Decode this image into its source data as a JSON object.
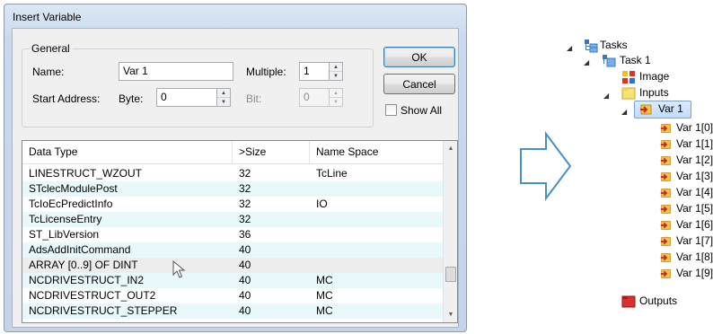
{
  "dialog": {
    "title": "Insert Variable",
    "general": {
      "legend": "General",
      "name_label": "Name:",
      "name_value": "Var 1",
      "multiple_label": "Multiple:",
      "multiple_value": "1",
      "start_address_label": "Start Address:",
      "byte_label": "Byte:",
      "byte_value": "0",
      "bit_label": "Bit:",
      "bit_value": "0"
    },
    "ok_label": "OK",
    "cancel_label": "Cancel",
    "show_all_label": "Show All",
    "show_all_checked": false,
    "list": {
      "columns": [
        "Data Type",
        ">Size",
        "Name Space"
      ],
      "rows": [
        {
          "type": "LINESTRUCT_WZOUT",
          "size": "32",
          "ns": "TcLine"
        },
        {
          "type": "STclecModulePost",
          "size": "32",
          "ns": ""
        },
        {
          "type": "TcIoEcPredictInfo",
          "size": "32",
          "ns": "IO"
        },
        {
          "type": "TcLicenseEntry",
          "size": "32",
          "ns": ""
        },
        {
          "type": "ST_LibVersion",
          "size": "36",
          "ns": ""
        },
        {
          "type": "AdsAddInitCommand",
          "size": "40",
          "ns": ""
        },
        {
          "type": "ARRAY [0..9] OF DINT",
          "size": "40",
          "ns": ""
        },
        {
          "type": "NCDRIVESTRUCT_IN2",
          "size": "40",
          "ns": "MC"
        },
        {
          "type": "NCDRIVESTRUCT_OUT2",
          "size": "40",
          "ns": "MC"
        },
        {
          "type": "NCDRIVESTRUCT_STEPPER",
          "size": "40",
          "ns": "MC"
        }
      ]
    }
  },
  "tree": {
    "tasks": "Tasks",
    "task1": "Task 1",
    "image": "Image",
    "inputs": "Inputs",
    "var1": "Var 1",
    "children": [
      "Var 1[0]",
      "Var 1[1]",
      "Var 1[2]",
      "Var 1[3]",
      "Var 1[4]",
      "Var 1[5]",
      "Var 1[6]",
      "Var 1[7]",
      "Var 1[8]",
      "Var 1[9]"
    ],
    "outputs": "Outputs"
  },
  "icons": {
    "expanded": "triangle-expanded-icon",
    "tasks": "tasks-icon",
    "task": "task-icon",
    "image": "image-icon",
    "inputs": "inputs-folder-icon",
    "variable": "variable-arrow-icon",
    "outputs": "outputs-folder-icon",
    "cursor": "mouse-pointer-icon",
    "arrow": "right-arrow-icon"
  },
  "colors": {
    "alt_row": "#e8f8fb",
    "selection": "#c1dbfc",
    "arrow_stroke": "#4a90c8"
  }
}
